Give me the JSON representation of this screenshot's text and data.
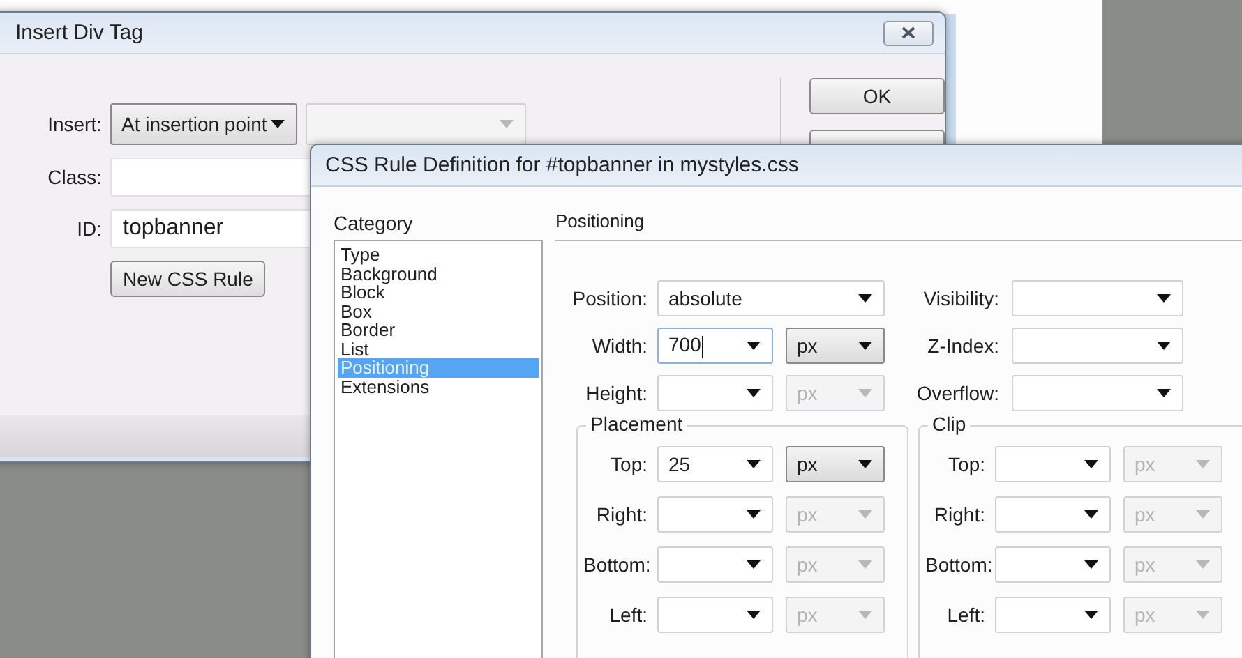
{
  "insert_div_dialog": {
    "title": "Insert Div Tag",
    "fields": [
      {
        "label": "Insert:",
        "kind": "select",
        "value": "At insertion point"
      },
      {
        "label": "Class:",
        "kind": "text"
      },
      {
        "label": "ID:",
        "kind": "text",
        "value": "topbanner"
      }
    ],
    "secondary_select": {
      "disabled": true
    },
    "new_rule_button": "New CSS Rule",
    "ok_button": "OK"
  },
  "css_rule_dialog": {
    "title": "CSS Rule Definition for #topbanner in mystyles.css",
    "category_label": "Category",
    "categories": [
      {
        "label": "Type",
        "selected": false
      },
      {
        "label": "Background",
        "selected": false
      },
      {
        "label": "Block",
        "selected": false
      },
      {
        "label": "Box",
        "selected": false
      },
      {
        "label": "Border",
        "selected": false
      },
      {
        "label": "List",
        "selected": false
      },
      {
        "label": "Positioning",
        "selected": true
      },
      {
        "label": "Extensions",
        "selected": false
      }
    ],
    "panel_title": "Positioning",
    "left_fields": [
      {
        "label": "Position:",
        "kind": "select",
        "value": "absolute"
      },
      {
        "label": "Width:",
        "kind": "combo",
        "value": "700",
        "focused": true,
        "unit": "px",
        "unit_disabled": false
      },
      {
        "label": "Height:",
        "kind": "combo",
        "focused": false,
        "unit": "px",
        "unit_disabled": true
      }
    ],
    "right_fields": [
      {
        "label": "Visibility:"
      },
      {
        "label": "Z-Index:"
      },
      {
        "label": "Overflow:"
      }
    ],
    "groups": [
      {
        "title": "Placement",
        "rows": [
          {
            "label": "Top:",
            "value": "25",
            "unit": "px",
            "unit_disabled": false
          },
          {
            "label": "Right:",
            "unit": "px",
            "unit_disabled": true
          },
          {
            "label": "Bottom:",
            "unit": "px",
            "unit_disabled": true
          },
          {
            "label": "Left:",
            "unit": "px",
            "unit_disabled": true
          }
        ]
      },
      {
        "title": "Clip",
        "rows": [
          {
            "label": "Top:",
            "unit": "px",
            "unit_disabled": true
          },
          {
            "label": "Right:",
            "unit": "px",
            "unit_disabled": true
          },
          {
            "label": "Bottom:",
            "unit": "px",
            "unit_disabled": true
          },
          {
            "label": "Left:",
            "unit": "px",
            "unit_disabled": true
          }
        ]
      }
    ]
  }
}
